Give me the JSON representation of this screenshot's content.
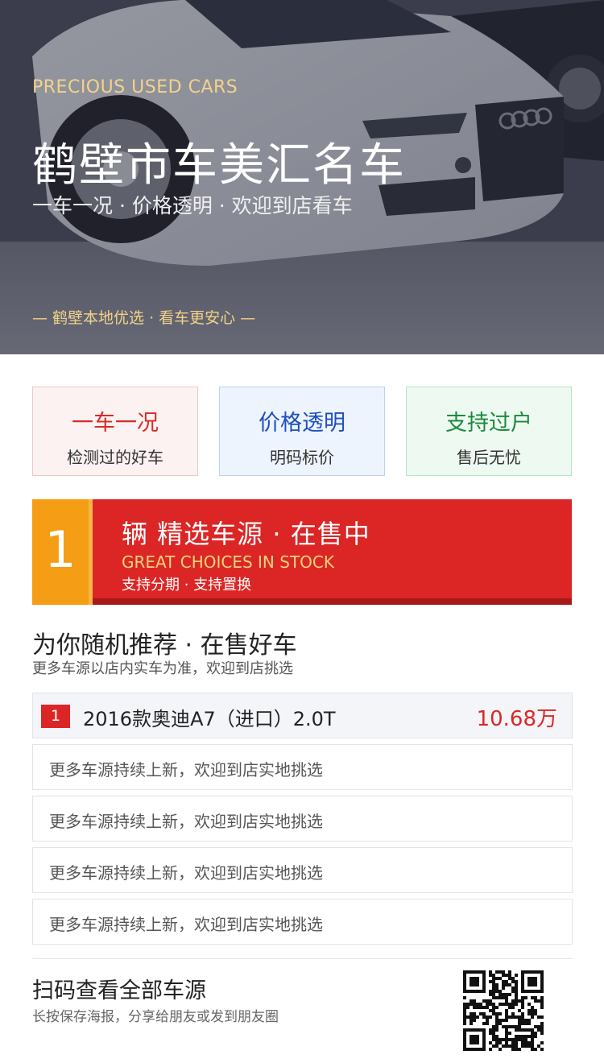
{
  "hero": {
    "subtitle_en": "PRECIOUS USED CARS",
    "title": "鹤壁市车美汇名车",
    "tagline": "一车一况 · 价格透明 · 欢迎到店看车",
    "footer": "— 鹤壁本地优选 · 看车更安心 —"
  },
  "features": [
    {
      "title": "一车一况",
      "subtitle": "检测过的好车"
    },
    {
      "title": "价格透明",
      "subtitle": "明码标价"
    },
    {
      "title": "支持过户",
      "subtitle": "售后无忧"
    }
  ],
  "stock": {
    "count": "1",
    "title": "辆 精选车源 · 在售中",
    "subtitle_en": "GREAT CHOICES IN STOCK",
    "note": "支持分期 · 支持置换"
  },
  "recommend": {
    "title": "为你随机推荐 · 在售好车",
    "subtitle": "更多车源以店内实车为准，欢迎到店挑选",
    "cars": [
      {
        "index": "1",
        "name": "2016款奥迪A7（进口）2.0T",
        "price": "10.68万"
      }
    ],
    "placeholders": [
      "更多车源持续上新，欢迎到店实地挑选",
      "更多车源持续上新，欢迎到店实地挑选",
      "更多车源持续上新，欢迎到店实地挑选",
      "更多车源持续上新，欢迎到店实地挑选"
    ]
  },
  "scan": {
    "title": "扫码查看全部车源",
    "subtitle": "长按保存海报，分享给朋友或发到朋友圈"
  },
  "colors": {
    "accent_red": "#dc2626",
    "accent_orange": "#f59d14",
    "gold": "#f2d38a"
  }
}
